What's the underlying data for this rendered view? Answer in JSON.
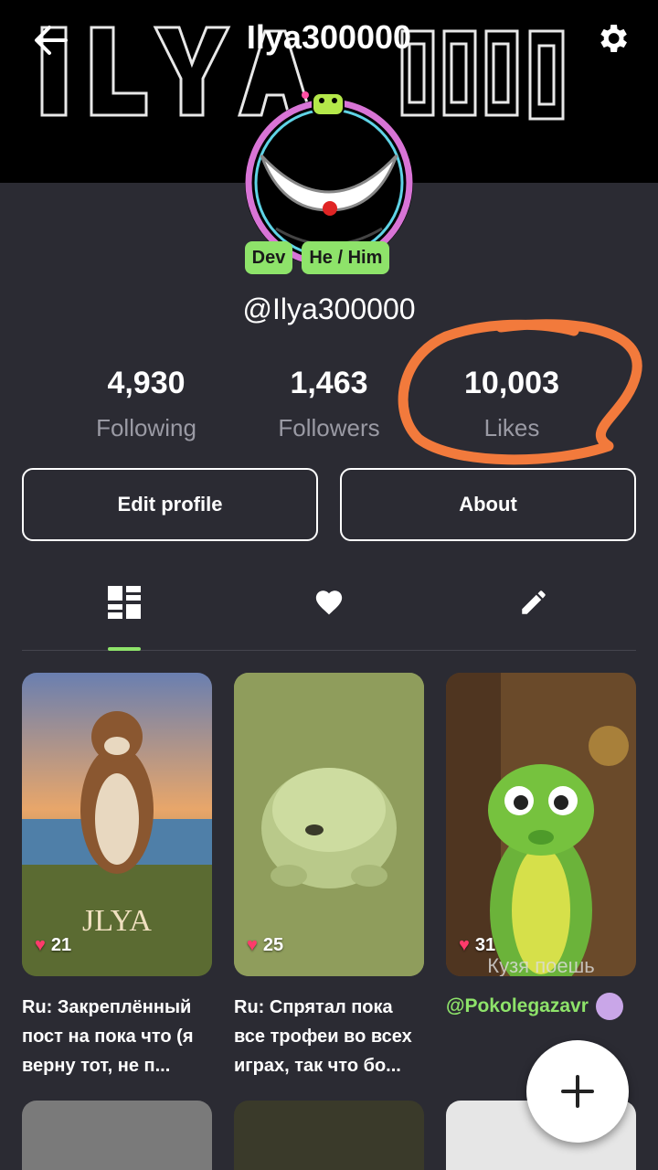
{
  "header": {
    "title": "Ilya300000",
    "back_icon": "arrow-left-icon",
    "settings_icon": "gear-icon"
  },
  "profile": {
    "badges": [
      "Dev",
      "He / Him"
    ],
    "handle": "@Ilya300000",
    "accent_color": "#8ee36a"
  },
  "stats": [
    {
      "value": "4,930",
      "label": "Following"
    },
    {
      "value": "1,463",
      "label": "Followers"
    },
    {
      "value": "10,003",
      "label": "Likes"
    }
  ],
  "actions": {
    "edit_label": "Edit profile",
    "about_label": "About"
  },
  "tabs": [
    {
      "icon": "grid-icon",
      "active": true
    },
    {
      "icon": "heart-icon",
      "active": false
    },
    {
      "icon": "pencil-icon",
      "active": false
    }
  ],
  "posts": [
    {
      "likes": "21",
      "caption": "Ru: Закреплённый пост на пока что (я верну тот, не п...",
      "overlay_text": "JLYA"
    },
    {
      "likes": "25",
      "caption": "Ru: Спрятал пока все трофеи во всех играх, так что бо..."
    },
    {
      "likes": "31",
      "author": "@Pokolegazavr",
      "overlay_text": "Кузя поешь"
    }
  ],
  "fab_icon": "plus-icon"
}
